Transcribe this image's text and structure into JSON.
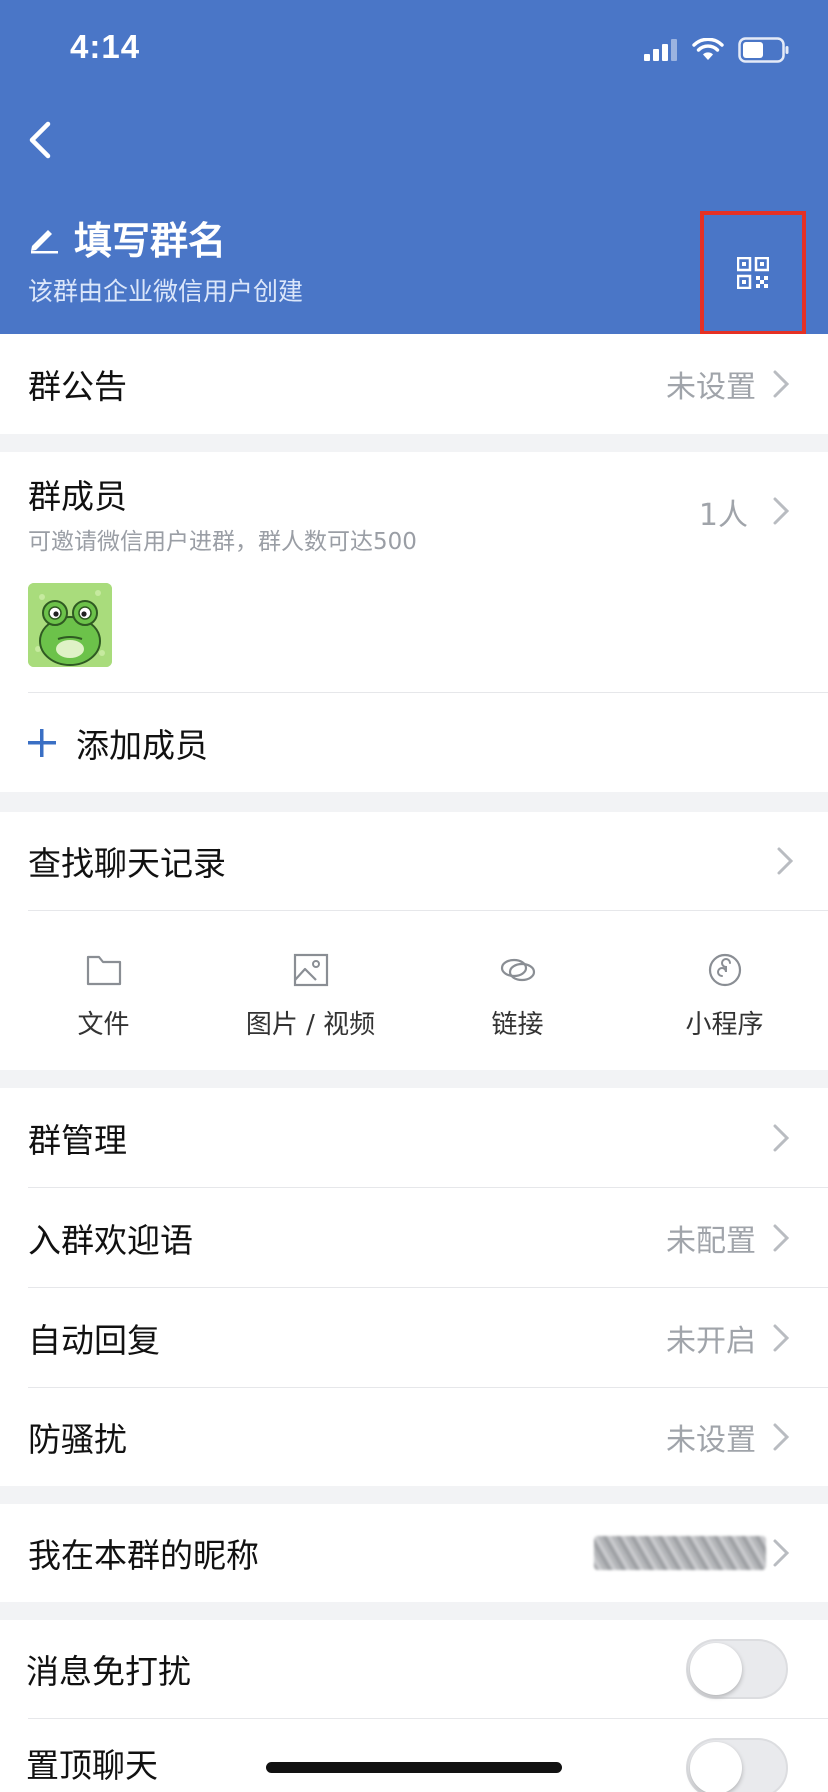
{
  "status_bar": {
    "time": "4:14"
  },
  "header": {
    "title": "填写群名",
    "subtitle": "该群由企业微信用户创建"
  },
  "announcement": {
    "label": "群公告",
    "value": "未设置"
  },
  "members": {
    "label": "群成员",
    "subtitle": "可邀请微信用户进群，群人数可达500",
    "count": "1人",
    "add_label": "添加成员"
  },
  "search_history": {
    "label": "查找聊天记录",
    "media": [
      {
        "label": "文件",
        "icon": "folder-icon"
      },
      {
        "label": "图片 / 视频",
        "icon": "image-icon"
      },
      {
        "label": "链接",
        "icon": "link-icon"
      },
      {
        "label": "小程序",
        "icon": "mini-program-icon"
      }
    ]
  },
  "management": [
    {
      "label": "群管理",
      "value": ""
    },
    {
      "label": "入群欢迎语",
      "value": "未配置"
    },
    {
      "label": "自动回复",
      "value": "未开启"
    },
    {
      "label": "防骚扰",
      "value": "未设置"
    }
  ],
  "nickname": {
    "label": "我在本群的昵称"
  },
  "toggles": [
    {
      "label": "消息免打扰",
      "on": false
    },
    {
      "label": "置顶聊天",
      "on": false
    }
  ],
  "colors": {
    "header_bg": "#4a76c7",
    "highlight_border": "#e53124",
    "accent": "#3a6fc4"
  }
}
